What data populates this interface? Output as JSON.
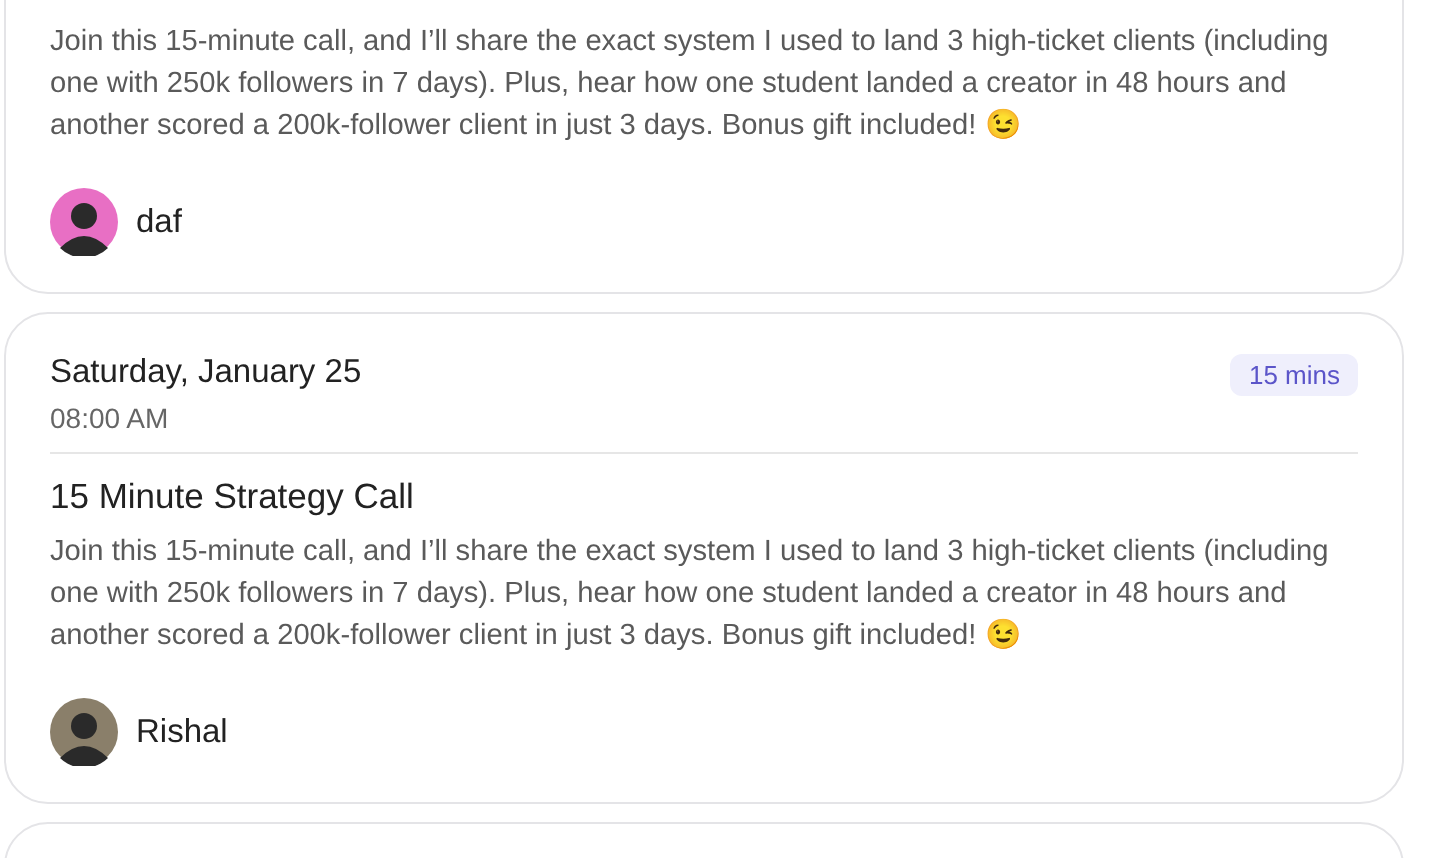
{
  "sessions": [
    {
      "description": "Join this 15-minute call, and I’ll share the exact system I used to land 3 high-ticket clients (including one with 250k followers in 7 days). Plus, hear how one student landed a creator in 48 hours and another scored a 200k-follower client in just 3 days. Bonus gift included! 😉",
      "host": {
        "name": "daf",
        "color": "#e86fc4"
      }
    },
    {
      "date": "Saturday, January 25",
      "time": "08:00 AM",
      "duration": "15 mins",
      "title": "15 Minute Strategy Call",
      "description": "Join this 15-minute call, and I’ll share the exact system I used to land 3 high-ticket clients (including one with 250k followers in 7 days). Plus, hear how one student landed a creator in 48 hours and another scored a 200k-follower client in just 3 days. Bonus gift included! 😉",
      "host": {
        "name": "Rishal",
        "color": "#8a7f6a"
      }
    }
  ]
}
